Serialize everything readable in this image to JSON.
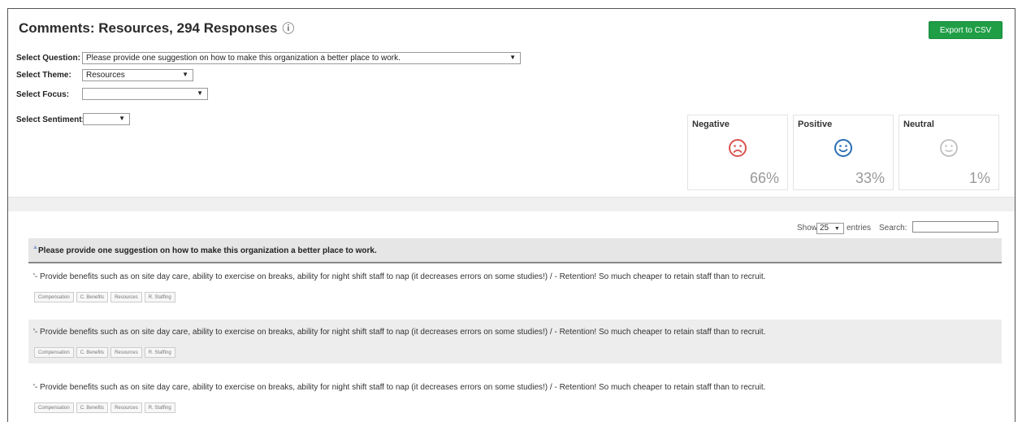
{
  "header": {
    "title": "Comments: Resources, 294 Responses",
    "info_icon": "ⓘ",
    "export_label": "Export to CSV"
  },
  "filters": {
    "question_label": "Select Question:",
    "question_value": "Please provide one suggestion on how to make this organization a better place to work.",
    "theme_label": "Select Theme:",
    "theme_value": "Resources",
    "focus_label": "Select Focus:",
    "focus_value": "",
    "sentiment_label": "Select Sentiment:",
    "sentiment_value": ""
  },
  "sentiment": [
    {
      "label": "Negative",
      "percent": "66%",
      "icon": "sad-face-icon",
      "color": "#d9534f"
    },
    {
      "label": "Positive",
      "percent": "33%",
      "icon": "smile-face-icon",
      "color": "#2a6db5"
    },
    {
      "label": "Neutral",
      "percent": "1%",
      "icon": "neutral-face-icon",
      "color": "#bfbfbf"
    }
  ],
  "table_controls": {
    "show_label": "Show",
    "entries_value": "25",
    "entries_label": "entries",
    "search_label": "Search:"
  },
  "table": {
    "header": "Please provide one suggestion on how to make this organization a better place to work.",
    "rows": [
      {
        "text": "'- Provide benefits such as on site day care, ability to exercise on breaks, ability for night shift staff to nap (it decreases errors on some studies!) / - Retention! So much cheaper to retain staff than to recruit.",
        "tags": [
          "Compensation",
          "C. Benefits",
          "Resources",
          "R. Staffing"
        ]
      },
      {
        "text": "'- Provide benefits such as on site day care, ability to exercise on breaks, ability for night shift staff to nap (it decreases errors on some studies!) / - Retention! So much cheaper to retain staff than to recruit.",
        "tags": [
          "Compensation",
          "C. Benefits",
          "Resources",
          "R. Staffing"
        ]
      },
      {
        "text": "'- Provide benefits such as on site day care, ability to exercise on breaks, ability for night shift staff to nap (it decreases errors on some studies!) / - Retention! So much cheaper to retain staff than to recruit.",
        "tags": [
          "Compensation",
          "C. Benefits",
          "Resources",
          "R. Staffing"
        ]
      }
    ]
  },
  "colors": {
    "export_button": "#1f9e46"
  }
}
